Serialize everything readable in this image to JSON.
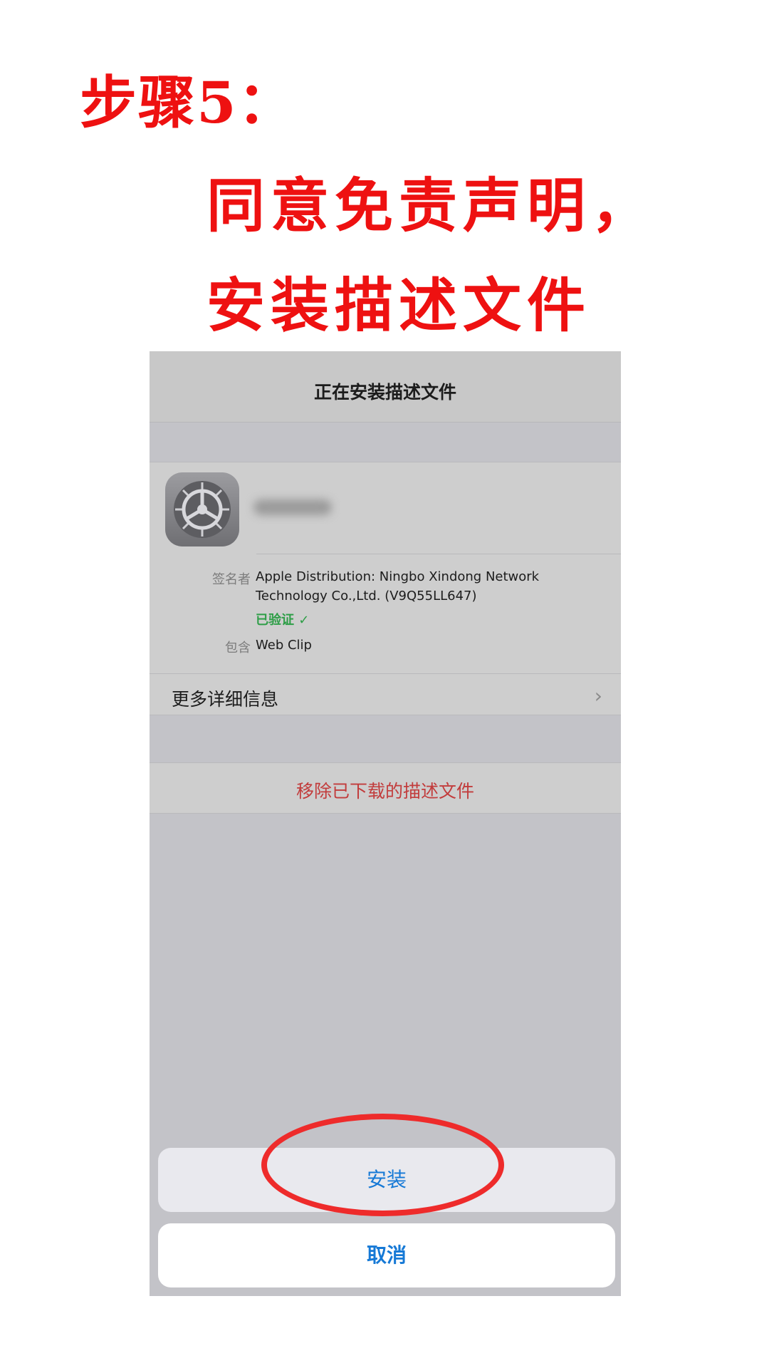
{
  "tutorial": {
    "step_title": "步骤5：",
    "instruction_line1": "同意免责声明，",
    "instruction_line2": "安装描述文件"
  },
  "nav": {
    "title": "正在安装描述文件"
  },
  "profile": {
    "icon": "settings-gear-icon",
    "signer_label": "签名者",
    "signer_line1": "Apple Distribution: Ningbo Xindong Network",
    "signer_line2": "Technology Co.,Ltd. (V9Q55LL647)",
    "verified": "已验证 ✓",
    "contains_label": "包含",
    "contains_value": "Web Clip",
    "more_info": "更多详细信息"
  },
  "remove_button": "移除已下载的描述文件",
  "action_sheet": {
    "install": "安装",
    "cancel": "取消"
  },
  "colors": {
    "annotation_red": "#ee1111",
    "verified_green": "#2e9e47",
    "ios_blue": "#1679d6",
    "destructive_red": "#c23c3c"
  }
}
